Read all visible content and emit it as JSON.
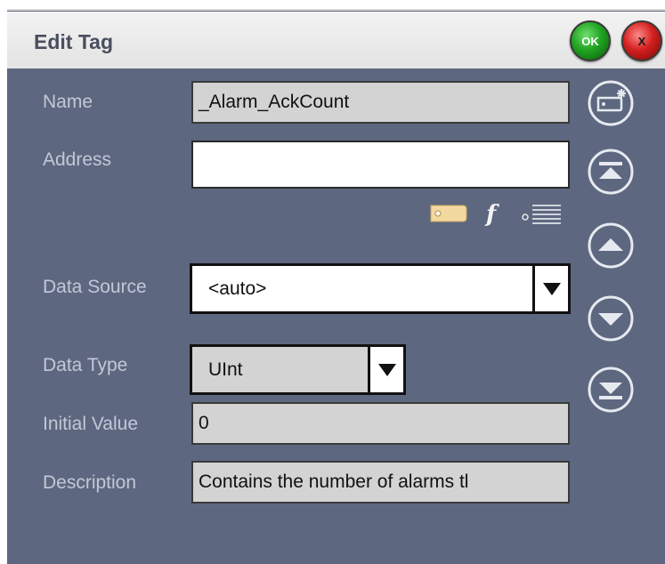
{
  "dialog": {
    "title": "Edit Tag",
    "ok_label": "OK",
    "cancel_label": "X"
  },
  "fields": {
    "name": {
      "label": "Name",
      "value": "_Alarm_AckCount"
    },
    "address": {
      "label": "Address",
      "value": ""
    },
    "data_source": {
      "label": "Data Source",
      "value": "<auto>"
    },
    "data_type": {
      "label": "Data Type",
      "value": "UInt"
    },
    "initial_value": {
      "label": "Initial Value",
      "value": "0"
    },
    "description": {
      "label": "Description",
      "value": "Contains the number of alarms tl"
    }
  },
  "address_tools": {
    "function_glyph": "f"
  },
  "icons": {
    "side": [
      "new-tag-icon",
      "move-to-top-icon",
      "move-up-icon",
      "move-down-icon",
      "move-to-bottom-icon"
    ],
    "address": [
      "tag-browse-icon",
      "function-icon",
      "list-icon"
    ]
  },
  "colors": {
    "panel_bg": "#5d6780",
    "label_text": "#c2c8d6",
    "ok_green": "#21a321",
    "cancel_red": "#d42020"
  }
}
